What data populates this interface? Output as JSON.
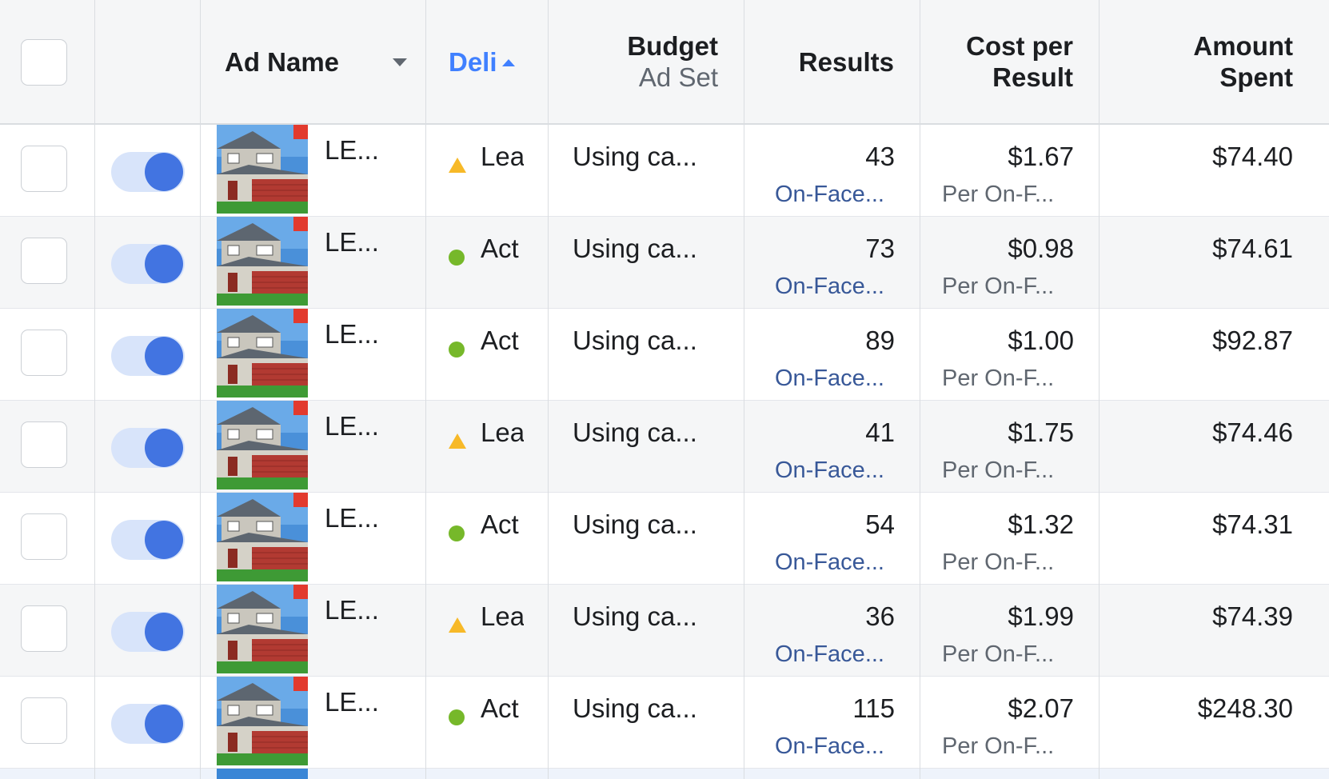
{
  "header": {
    "select_all_checkbox": false,
    "ad_name": "Ad Name",
    "delivery": "Deli",
    "budget": "Budget",
    "budget_sub": "Ad Set",
    "results": "Results",
    "cost_per_result_1": "Cost per",
    "cost_per_result_2": "Result",
    "amount_spent_1": "Amount",
    "amount_spent_2": "Spent"
  },
  "colors": {
    "accent_blue": "#4080ff",
    "toggle_on": "#4274e1",
    "status_active": "#76b82a",
    "status_learning": "#f7b928",
    "link": "#385898"
  },
  "rows": [
    {
      "checked": false,
      "toggle_on": true,
      "ad_name": "LE...",
      "delivery_status": "learning",
      "delivery": "Lea",
      "budget": "Using ca...",
      "results": "43",
      "results_sub": "On-Face...",
      "cost_per_result": "$1.67",
      "cost_sub": "Per On-F...",
      "amount_spent": "$74.40",
      "thumb_icon": "house-thumbnail"
    },
    {
      "checked": false,
      "toggle_on": true,
      "ad_name": "LE...",
      "delivery_status": "active",
      "delivery": "Act",
      "budget": "Using ca...",
      "results": "73",
      "results_sub": "On-Face...",
      "cost_per_result": "$0.98",
      "cost_sub": "Per On-F...",
      "amount_spent": "$74.61",
      "thumb_icon": "house-thumbnail"
    },
    {
      "checked": false,
      "toggle_on": true,
      "ad_name": "LE...",
      "delivery_status": "active",
      "delivery": "Act",
      "budget": "Using ca...",
      "results": "89",
      "results_sub": "On-Face...",
      "cost_per_result": "$1.00",
      "cost_sub": "Per On-F...",
      "amount_spent": "$92.87",
      "thumb_icon": "house-thumbnail"
    },
    {
      "checked": false,
      "toggle_on": true,
      "ad_name": "LE...",
      "delivery_status": "learning",
      "delivery": "Lea",
      "budget": "Using ca...",
      "results": "41",
      "results_sub": "On-Face...",
      "cost_per_result": "$1.75",
      "cost_sub": "Per On-F...",
      "amount_spent": "$74.46",
      "thumb_icon": "house-thumbnail"
    },
    {
      "checked": false,
      "toggle_on": true,
      "ad_name": "LE...",
      "delivery_status": "active",
      "delivery": "Act",
      "budget": "Using ca...",
      "results": "54",
      "results_sub": "On-Face...",
      "cost_per_result": "$1.32",
      "cost_sub": "Per On-F...",
      "amount_spent": "$74.31",
      "thumb_icon": "house-thumbnail"
    },
    {
      "checked": false,
      "toggle_on": true,
      "ad_name": "LE...",
      "delivery_status": "learning",
      "delivery": "Lea",
      "budget": "Using ca...",
      "results": "36",
      "results_sub": "On-Face...",
      "cost_per_result": "$1.99",
      "cost_sub": "Per On-F...",
      "amount_spent": "$74.39",
      "thumb_icon": "house-thumbnail"
    },
    {
      "checked": false,
      "toggle_on": true,
      "ad_name": "LE...",
      "delivery_status": "active",
      "delivery": "Act",
      "budget": "Using ca...",
      "results": "115",
      "results_sub": "On-Face...",
      "cost_per_result": "$2.07",
      "cost_sub": "Per On-F...",
      "amount_spent": "$248.30",
      "thumb_icon": "house-thumbnail"
    }
  ]
}
